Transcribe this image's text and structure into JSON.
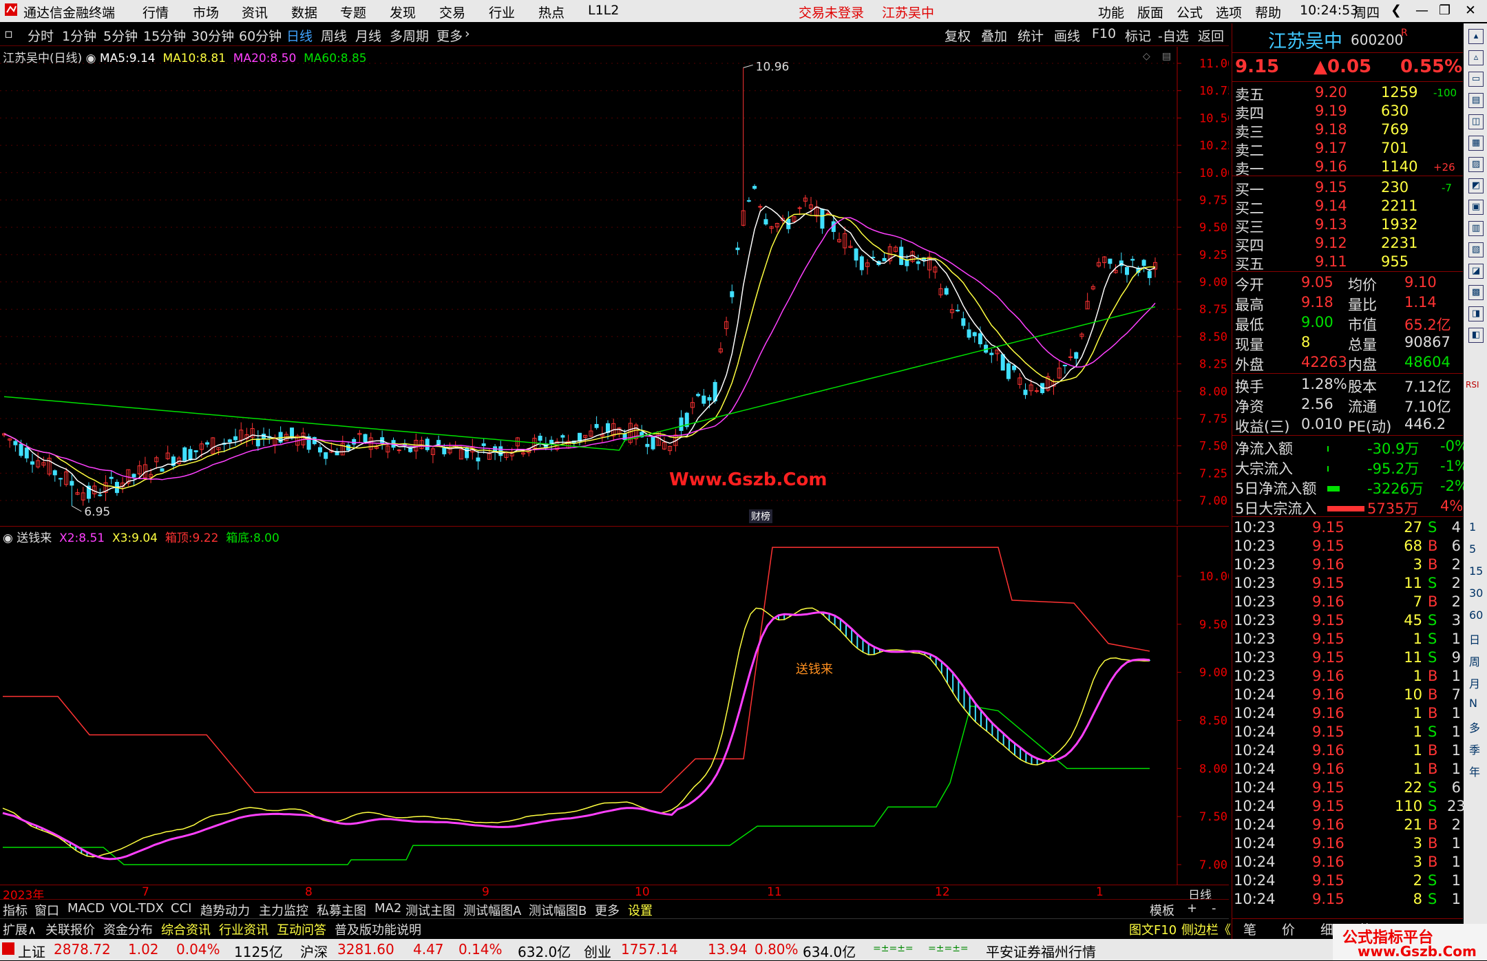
{
  "titlebar": {
    "app_name": "通达信金融终端",
    "menu": [
      "行情",
      "市场",
      "资讯",
      "数据",
      "专题",
      "发现",
      "交易",
      "行业",
      "热点",
      "L1L2"
    ],
    "trade_status": "交易未登录",
    "stock_name": "江苏吴中",
    "right_menu": [
      "功能",
      "版面",
      "公式",
      "选项",
      "帮助"
    ],
    "time": "10:24:53",
    "weekday": "周四"
  },
  "periodbar": {
    "periods": [
      "分时",
      "1分钟",
      "5分钟",
      "15分钟",
      "30分钟",
      "60分钟",
      "日线",
      "周线",
      "月线",
      "多周期",
      "更多"
    ],
    "active": "日线",
    "tools": [
      "复权",
      "叠加",
      "统计",
      "画线",
      "F10",
      "标记",
      "-自选",
      "返回"
    ]
  },
  "main_chart": {
    "title": "江苏吴中(日线)",
    "ma": [
      {
        "label": "MA5:",
        "value": "9.14",
        "color": "#ffffff"
      },
      {
        "label": "MA10:",
        "value": "8.81",
        "color": "#ffff40"
      },
      {
        "label": "MA20:",
        "value": "8.50",
        "color": "#ff40ff"
      },
      {
        "label": "MA60:",
        "value": "8.85",
        "color": "#00e000"
      }
    ],
    "y_ticks": [
      "11.00",
      "10.75",
      "10.50",
      "10.25",
      "10.00",
      "9.75",
      "9.50",
      "9.25",
      "9.00",
      "8.75",
      "8.50",
      "8.25",
      "8.00",
      "7.75",
      "7.50",
      "7.25",
      "7.00"
    ],
    "high_mark": "10.96",
    "low_mark": "6.95",
    "watermark": "Www.Gszb.Com",
    "badge": "财榜"
  },
  "sub_chart": {
    "title": "送钱来",
    "legend": [
      {
        "label": "X2:",
        "value": "8.51",
        "color": "#ff40ff"
      },
      {
        "label": "X3:",
        "value": "9.04",
        "color": "#ffff40"
      },
      {
        "label": "箱顶:",
        "value": "9.22",
        "color": "#ff3333"
      },
      {
        "label": "箱底:",
        "value": "8.00",
        "color": "#00e000"
      }
    ],
    "y_ticks": [
      "10.00",
      "9.50",
      "9.00",
      "8.50",
      "8.00",
      "7.50",
      "7.00"
    ],
    "annotation": "送钱来"
  },
  "x_axis": {
    "labels": [
      "2023年",
      "7",
      "8",
      "9",
      "10",
      "11",
      "12",
      "1"
    ],
    "period_label": "日线"
  },
  "quote": {
    "name": "江苏吴中",
    "code": "600200",
    "code_suffix": "R",
    "price": "9.15",
    "change": "▲0.05",
    "change_pct": "0.55%",
    "asks": [
      {
        "label": "卖五",
        "price": "9.20",
        "vol": "1259",
        "delta": "-100"
      },
      {
        "label": "卖四",
        "price": "9.19",
        "vol": "630",
        "delta": ""
      },
      {
        "label": "卖三",
        "price": "9.18",
        "vol": "769",
        "delta": ""
      },
      {
        "label": "卖二",
        "price": "9.17",
        "vol": "701",
        "delta": ""
      },
      {
        "label": "卖一",
        "price": "9.16",
        "vol": "1140",
        "delta": "+26"
      }
    ],
    "bids": [
      {
        "label": "买一",
        "price": "9.15",
        "vol": "230",
        "delta": "-7"
      },
      {
        "label": "买二",
        "price": "9.14",
        "vol": "2211",
        "delta": ""
      },
      {
        "label": "买三",
        "price": "9.13",
        "vol": "1932",
        "delta": ""
      },
      {
        "label": "买四",
        "price": "9.12",
        "vol": "2231",
        "delta": ""
      },
      {
        "label": "买五",
        "price": "9.11",
        "vol": "955",
        "delta": ""
      }
    ],
    "stats": [
      {
        "l1": "今开",
        "v1": "9.05",
        "l2": "均价",
        "v2": "9.10"
      },
      {
        "l1": "最高",
        "v1": "9.18",
        "l2": "量比",
        "v2": "1.14"
      },
      {
        "l1": "最低",
        "v1": "9.00",
        "l2": "市值",
        "v2": "65.2亿"
      },
      {
        "l1": "现量",
        "v1": "8",
        "l2": "总量",
        "v2": "90867"
      },
      {
        "l1": "外盘",
        "v1": "42263",
        "l2": "内盘",
        "v2": "48604"
      }
    ],
    "stats2": [
      {
        "l1": "换手",
        "v1": "1.28%",
        "l2": "股本",
        "v2": "7.12亿"
      },
      {
        "l1": "净资",
        "v1": "2.56",
        "l2": "流通",
        "v2": "7.10亿"
      },
      {
        "l1": "收益(三)",
        "v1": "0.010",
        "l2": "PE(动)",
        "v2": "446.2"
      }
    ],
    "flows": [
      {
        "label": "净流入额",
        "value": "-30.9万",
        "pct": "-0%"
      },
      {
        "label": "大宗流入",
        "value": "-95.2万",
        "pct": "-1%"
      },
      {
        "label": "5日净流入额",
        "value": "-3226万",
        "pct": "-2%"
      },
      {
        "label": "5日大宗流入",
        "value": "5735万",
        "pct": "4%"
      }
    ],
    "ticks": [
      {
        "t": "10:23",
        "p": "9.15",
        "v": "27",
        "bs": "S",
        "n": "4"
      },
      {
        "t": "10:23",
        "p": "9.15",
        "v": "68",
        "bs": "B",
        "n": "6"
      },
      {
        "t": "10:23",
        "p": "9.16",
        "v": "3",
        "bs": "B",
        "n": "2"
      },
      {
        "t": "10:23",
        "p": "9.15",
        "v": "11",
        "bs": "S",
        "n": "2"
      },
      {
        "t": "10:23",
        "p": "9.16",
        "v": "7",
        "bs": "B",
        "n": "2"
      },
      {
        "t": "10:23",
        "p": "9.15",
        "v": "45",
        "bs": "S",
        "n": "3"
      },
      {
        "t": "10:23",
        "p": "9.15",
        "v": "1",
        "bs": "S",
        "n": "1"
      },
      {
        "t": "10:23",
        "p": "9.15",
        "v": "11",
        "bs": "S",
        "n": "9"
      },
      {
        "t": "10:23",
        "p": "9.16",
        "v": "1",
        "bs": "B",
        "n": "1"
      },
      {
        "t": "10:24",
        "p": "9.16",
        "v": "10",
        "bs": "B",
        "n": "7"
      },
      {
        "t": "10:24",
        "p": "9.16",
        "v": "1",
        "bs": "B",
        "n": "1"
      },
      {
        "t": "10:24",
        "p": "9.15",
        "v": "1",
        "bs": "S",
        "n": "1"
      },
      {
        "t": "10:24",
        "p": "9.16",
        "v": "1",
        "bs": "B",
        "n": "1"
      },
      {
        "t": "10:24",
        "p": "9.16",
        "v": "1",
        "bs": "B",
        "n": "1"
      },
      {
        "t": "10:24",
        "p": "9.15",
        "v": "22",
        "bs": "S",
        "n": "6"
      },
      {
        "t": "10:24",
        "p": "9.15",
        "v": "110",
        "bs": "S",
        "n": "23"
      },
      {
        "t": "10:24",
        "p": "9.16",
        "v": "21",
        "bs": "B",
        "n": "2"
      },
      {
        "t": "10:24",
        "p": "9.16",
        "v": "3",
        "bs": "B",
        "n": "1"
      },
      {
        "t": "10:24",
        "p": "9.16",
        "v": "3",
        "bs": "B",
        "n": "1"
      },
      {
        "t": "10:24",
        "p": "9.15",
        "v": "2",
        "bs": "S",
        "n": "1"
      },
      {
        "t": "10:24",
        "p": "9.15",
        "v": "8",
        "bs": "S",
        "n": "1"
      }
    ],
    "bottom_tabs": [
      "笔",
      "价",
      "细",
      "势"
    ]
  },
  "iconstrip": {
    "labels": [
      "1",
      "5",
      "15",
      "30",
      "60",
      "日",
      "周",
      "月",
      "N",
      "多",
      "季",
      "年"
    ],
    "icons": [
      "RSI",
      "F10"
    ]
  },
  "tabbar": {
    "items": [
      "指标",
      "窗口",
      "MACD",
      "VOL-TDX",
      "CCI",
      "趋势动力",
      "主力监控",
      "私募主图",
      "MA2",
      "测试主图",
      "测试幅图A",
      "测试幅图B",
      "更多",
      "设置"
    ],
    "right": [
      "模板",
      "+",
      "-"
    ]
  },
  "tabbar2": {
    "items": [
      "扩展∧",
      "关联报价",
      "资金分布",
      "综合资讯",
      "行业资讯",
      "互动问答",
      "普及版功能说明"
    ],
    "right": [
      "图文F10",
      "侧边栏《"
    ]
  },
  "statusbar": {
    "indices": [
      {
        "name": "上证",
        "value": "2878.72",
        "chg": "1.02",
        "pct": "0.04%",
        "amt": "1125亿"
      },
      {
        "name": "沪深",
        "value": "3281.60",
        "chg": "4.47",
        "pct": "0.14%",
        "amt": "632.0亿"
      },
      {
        "name": "创业",
        "value": "1757.14",
        "chg": "13.94",
        "pct": "0.80%",
        "amt": "634.0亿"
      }
    ],
    "broker": "平安证券福州行情",
    "brand": "公式指标平台",
    "brand_url": "www.Gszb.Com"
  },
  "colors": {
    "up": "#ff3333",
    "down": "#40e0ff",
    "ma5": "#ffffff",
    "ma10": "#ffff40",
    "ma20": "#ff40ff",
    "ma60": "#00e000",
    "axis": "#aa0000"
  }
}
